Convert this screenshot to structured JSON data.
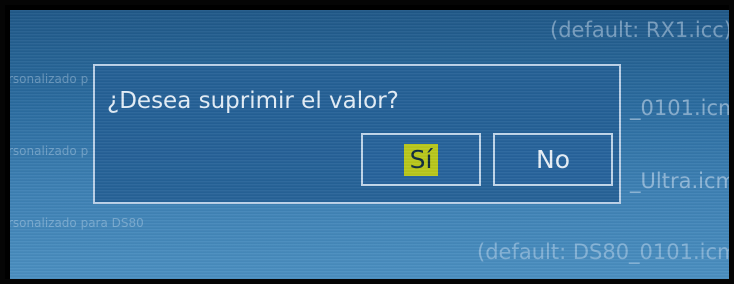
{
  "background": {
    "default_top": "(default: RX1.icc)",
    "labels": [
      "rsonalizado p",
      "rsonalizado p",
      "rsonalizado para DS80"
    ],
    "icm_1": "_0101.icm)",
    "icm_2": "_Ultra.icm",
    "default_bottom": "(default: DS80_0101.icm"
  },
  "dialog": {
    "message": "¿Desea suprimir el valor?",
    "yes_label": "Sí",
    "no_label": "No"
  },
  "colors": {
    "highlight": "#b9c81a",
    "screen_blue": "#2a6ca0",
    "dialog_blue": "#245f96"
  }
}
